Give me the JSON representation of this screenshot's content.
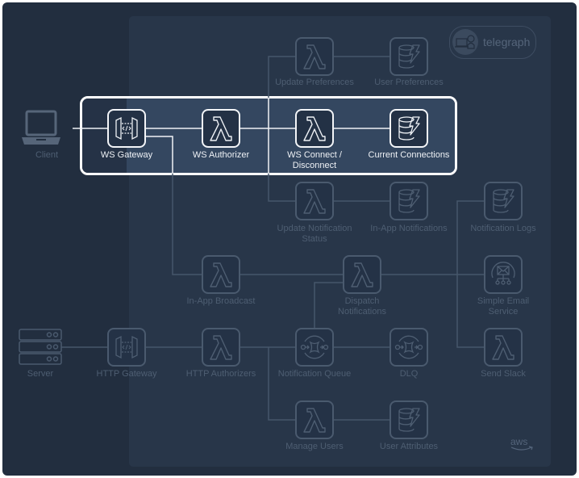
{
  "diagram": {
    "title": "telegraph",
    "badge_label": "telegraph",
    "provider_label": "aws",
    "colors": {
      "background": "#222e3f",
      "aws_region": "#283649",
      "highlight_fill": "#344760",
      "highlight_border": "#ffffff",
      "active_text": "#eef1f5",
      "inactive_text": "#4e5e72",
      "inactive_line": "#46566a"
    },
    "nodes": {
      "client": {
        "label": "Client",
        "icon": "laptop-icon"
      },
      "server": {
        "label": "Server",
        "icon": "server-rack-icon"
      },
      "ws_gateway": {
        "label": "WS Gateway",
        "icon": "api-gateway-icon",
        "highlighted": true
      },
      "ws_authorizer": {
        "label": "WS Authorizer",
        "icon": "lambda-icon",
        "highlighted": true
      },
      "ws_connect": {
        "label": "WS Connect /",
        "label2": "Disconnect",
        "icon": "lambda-icon",
        "highlighted": true
      },
      "current_connections": {
        "label": "Current Connections",
        "icon": "dynamodb-icon",
        "highlighted": true
      },
      "update_preferences": {
        "label": "Update Preferences",
        "icon": "lambda-icon"
      },
      "user_preferences": {
        "label": "User Preferences",
        "icon": "dynamodb-icon"
      },
      "update_notification_status": {
        "label": "Update Notification",
        "label2": "Status",
        "icon": "lambda-icon"
      },
      "in_app_notifications": {
        "label": "In-App Notifications",
        "icon": "dynamodb-icon"
      },
      "notification_logs": {
        "label": "Notification Logs",
        "icon": "dynamodb-icon"
      },
      "in_app_broadcast": {
        "label": "In-App Broadcast",
        "icon": "lambda-icon"
      },
      "dispatch_notifications": {
        "label": "Dispatch",
        "label2": "Notifications",
        "icon": "lambda-icon"
      },
      "simple_email_service": {
        "label": "Simple Email",
        "label2": "Service",
        "icon": "ses-icon"
      },
      "http_gateway": {
        "label": "HTTP Gateway",
        "icon": "api-gateway-icon"
      },
      "http_authorizers": {
        "label": "HTTP Authorizers",
        "icon": "lambda-icon"
      },
      "notification_queue": {
        "label": "Notification Queue",
        "icon": "sqs-icon"
      },
      "dlq": {
        "label": "DLQ",
        "icon": "sqs-icon"
      },
      "send_slack": {
        "label": "Send Slack",
        "icon": "lambda-icon"
      },
      "manage_users": {
        "label": "Manage Users",
        "icon": "lambda-icon"
      },
      "user_attributes": {
        "label": "User Attributes",
        "icon": "dynamodb-icon"
      }
    },
    "edges": [
      [
        "client",
        "ws_gateway"
      ],
      [
        "ws_gateway",
        "ws_authorizer"
      ],
      [
        "ws_authorizer",
        "ws_connect"
      ],
      [
        "ws_connect",
        "current_connections"
      ],
      [
        "ws_authorizer",
        "update_preferences"
      ],
      [
        "update_preferences",
        "user_preferences"
      ],
      [
        "ws_authorizer",
        "update_notification_status"
      ],
      [
        "update_notification_status",
        "in_app_notifications"
      ],
      [
        "ws_gateway",
        "in_app_broadcast"
      ],
      [
        "in_app_broadcast",
        "dispatch_notifications"
      ],
      [
        "dispatch_notifications",
        "notification_logs"
      ],
      [
        "dispatch_notifications",
        "simple_email_service"
      ],
      [
        "dispatch_notifications",
        "send_slack"
      ],
      [
        "server",
        "http_gateway"
      ],
      [
        "http_gateway",
        "http_authorizers"
      ],
      [
        "http_authorizers",
        "notification_queue"
      ],
      [
        "notification_queue",
        "dispatch_notifications"
      ],
      [
        "notification_queue",
        "dlq"
      ],
      [
        "http_authorizers",
        "manage_users"
      ],
      [
        "manage_users",
        "user_attributes"
      ]
    ]
  }
}
